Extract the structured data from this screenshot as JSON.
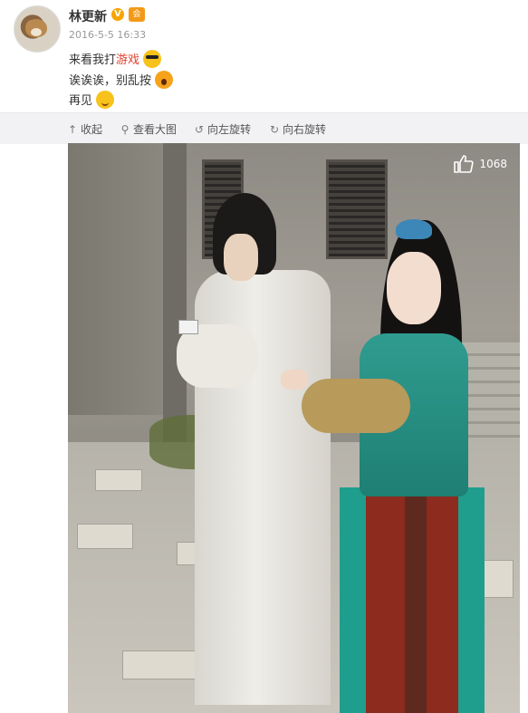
{
  "post": {
    "username": "林更新",
    "verified_badge": "V",
    "vip_badge": "会",
    "timestamp": "2016-5-5 16:33",
    "line1_prefix": "来看我打",
    "line1_highlight": "游戏",
    "line2": "诶诶诶，别乱按",
    "line3": "再见",
    "emojis": [
      "cool-sunglasses-emoji",
      "shocked-emoji",
      "shy-emoji"
    ]
  },
  "toolbar": {
    "collapse": "收起",
    "view_large": "查看大图",
    "rotate_left": "向左旋转",
    "rotate_right": "向右旋转"
  },
  "photo": {
    "like_count": "1068"
  },
  "colors": {
    "highlight": "#e5402b",
    "toolbar_bg": "#f2f2f5"
  }
}
